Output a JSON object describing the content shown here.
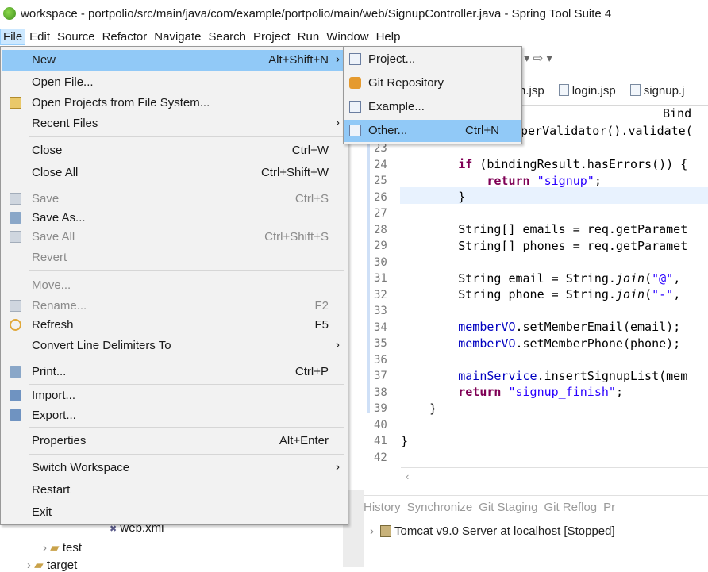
{
  "window": {
    "title": "workspace - portpolio/src/main/java/com/example/portpolio/main/web/SignupController.java - Spring Tool Suite 4"
  },
  "menubar": [
    "File",
    "Edit",
    "Source",
    "Refactor",
    "Navigate",
    "Search",
    "Project",
    "Run",
    "Window",
    "Help"
  ],
  "file_menu": {
    "new": {
      "label": "New",
      "accel": "Alt+Shift+N"
    },
    "open_file": {
      "label": "Open File..."
    },
    "open_projects": {
      "label": "Open Projects from File System..."
    },
    "recent_files": {
      "label": "Recent Files"
    },
    "close": {
      "label": "Close",
      "accel": "Ctrl+W"
    },
    "close_all": {
      "label": "Close All",
      "accel": "Ctrl+Shift+W"
    },
    "save": {
      "label": "Save",
      "accel": "Ctrl+S"
    },
    "save_as": {
      "label": "Save As..."
    },
    "save_all": {
      "label": "Save All",
      "accel": "Ctrl+Shift+S"
    },
    "revert": {
      "label": "Revert"
    },
    "move": {
      "label": "Move..."
    },
    "rename": {
      "label": "Rename...",
      "accel": "F2"
    },
    "refresh": {
      "label": "Refresh",
      "accel": "F5"
    },
    "convert": {
      "label": "Convert Line Delimiters To"
    },
    "print": {
      "label": "Print...",
      "accel": "Ctrl+P"
    },
    "import": {
      "label": "Import..."
    },
    "export": {
      "label": "Export..."
    },
    "properties": {
      "label": "Properties",
      "accel": "Alt+Enter"
    },
    "switch_workspace": {
      "label": "Switch Workspace"
    },
    "restart": {
      "label": "Restart"
    },
    "exit": {
      "label": "Exit"
    }
  },
  "new_submenu": {
    "project": {
      "label": "Project..."
    },
    "git_repository": {
      "label": "Git Repository"
    },
    "example": {
      "label": "Example..."
    },
    "other": {
      "label": "Other...",
      "accel": "Ctrl+N"
    }
  },
  "editor": {
    "tabs": [
      "n.jsp",
      "login.jsp",
      "signup.j"
    ],
    "line_numbers": [
      "23",
      "24",
      "25",
      "26",
      "27",
      "28",
      "29",
      "30",
      "31",
      "32",
      "33",
      "34",
      "35",
      "36",
      "37",
      "38",
      "39",
      "40",
      "41",
      "42"
    ],
    "partial_lines": {
      "bind": "Bind",
      "validator": "perValidator().validate("
    }
  },
  "bottom_panel": {
    "tabs": [
      "History",
      "Synchronize",
      "Git Staging",
      "Git Reflog",
      "Pr"
    ],
    "server": "Tomcat v9.0 Server at localhost  [Stopped]"
  },
  "explorer": {
    "items": [
      "web.xml",
      "test",
      "target"
    ]
  }
}
